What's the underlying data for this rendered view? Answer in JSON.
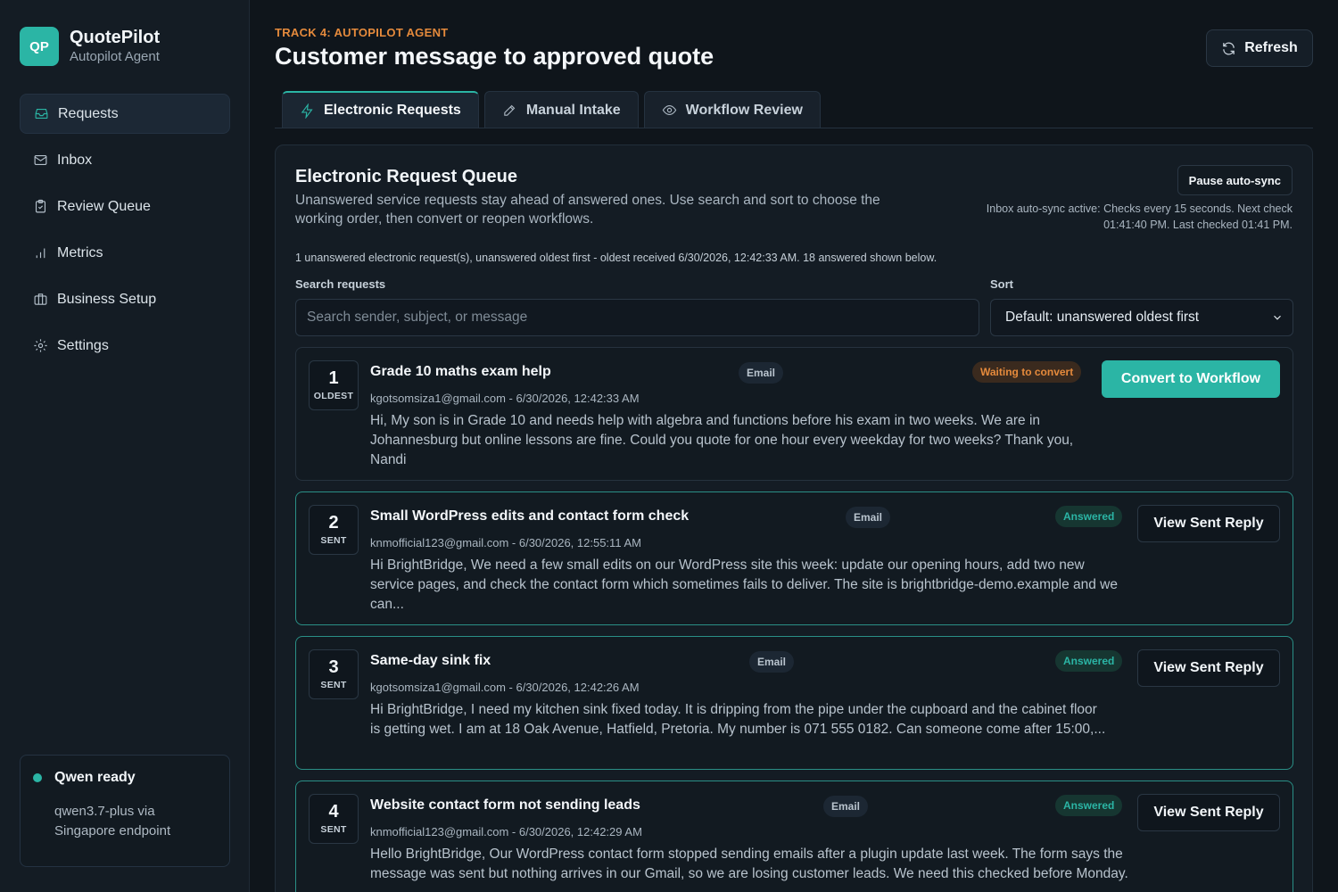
{
  "brand": {
    "logo": "QP",
    "name": "QuotePilot",
    "subtitle": "Autopilot Agent"
  },
  "sidebar": {
    "items": [
      {
        "label": "Requests",
        "icon": "inbox-tray-icon",
        "active": true
      },
      {
        "label": "Inbox",
        "icon": "mail-icon"
      },
      {
        "label": "Review Queue",
        "icon": "clipboard-check-icon"
      },
      {
        "label": "Metrics",
        "icon": "bar-chart-icon"
      },
      {
        "label": "Business Setup",
        "icon": "briefcase-icon"
      },
      {
        "label": "Settings",
        "icon": "gear-icon"
      }
    ],
    "status": {
      "title": "Qwen ready",
      "line1": "qwen3.7-plus via",
      "line2": "Singapore endpoint"
    }
  },
  "header": {
    "eyebrow": "TRACK 4: AUTOPILOT AGENT",
    "title": "Customer message to approved quote",
    "refresh_label": "Refresh"
  },
  "tabs": [
    {
      "label": "Electronic Requests",
      "icon": "lightning-icon",
      "active": true
    },
    {
      "label": "Manual Intake",
      "icon": "pencil-icon"
    },
    {
      "label": "Workflow Review",
      "icon": "eye-icon"
    }
  ],
  "queue": {
    "title": "Electronic Request Queue",
    "description": "Unanswered service requests stay ahead of answered ones. Use search and sort to choose the working order, then convert or reopen workflows.",
    "pause_label": "Pause auto-sync",
    "sync_note": "Inbox auto-sync active: Checks every 15 seconds. Next check 01:41:40 PM. Last checked 01:41 PM.",
    "summary": "1 unanswered electronic request(s), unanswered oldest first - oldest received 6/30/2026, 12:42:33 AM. 18 answered shown below.",
    "search_label": "Search requests",
    "search_placeholder": "Search sender, subject, or message",
    "sort_label": "Sort",
    "sort_value": "Default: unanswered oldest first"
  },
  "requests": [
    {
      "num": "1",
      "tag": "OLDEST",
      "title": "Grade 10 maths exam help",
      "channel": "Email",
      "status": "Waiting to convert",
      "meta": "kgotsomsiza1@gmail.com - 6/30/2026, 12:42:33 AM",
      "message": "Hi, My son is in Grade 10 and needs help with algebra and functions before his exam in two weeks. We are in Johannesburg but online lessons are fine. Could you quote for one hour every weekday for two weeks? Thank you, Nandi",
      "action": "Convert to Workflow"
    },
    {
      "num": "2",
      "tag": "SENT",
      "title": "Small WordPress edits and contact form check",
      "channel": "Email",
      "status": "Answered",
      "meta": "knmofficial123@gmail.com - 6/30/2026, 12:55:11 AM",
      "message": "Hi BrightBridge, We need a few small edits on our WordPress site this week: update our opening hours, add two new service pages, and check the contact form which sometimes fails to deliver. The site is brightbridge-demo.example and we can...",
      "action": "View Sent Reply"
    },
    {
      "num": "3",
      "tag": "SENT",
      "title": "Same-day sink fix",
      "channel": "Email",
      "status": "Answered",
      "meta": "kgotsomsiza1@gmail.com - 6/30/2026, 12:42:26 AM",
      "message": "Hi BrightBridge, I need my kitchen sink fixed today. It is dripping from the pipe under the cupboard and the cabinet floor is getting wet. I am at 18 Oak Avenue, Hatfield, Pretoria. My number is 071 555 0182. Can someone come after 15:00,...",
      "action": "View Sent Reply"
    },
    {
      "num": "4",
      "tag": "SENT",
      "title": "Website contact form not sending leads",
      "channel": "Email",
      "status": "Answered",
      "meta": "knmofficial123@gmail.com - 6/30/2026, 12:42:29 AM",
      "message": "Hello BrightBridge, Our WordPress contact form stopped sending emails after a plugin update last week. The form says the message was sent but nothing arrives in our Gmail, so we are losing customer leads. We need this checked before Monday.",
      "action": "View Sent Reply"
    }
  ]
}
